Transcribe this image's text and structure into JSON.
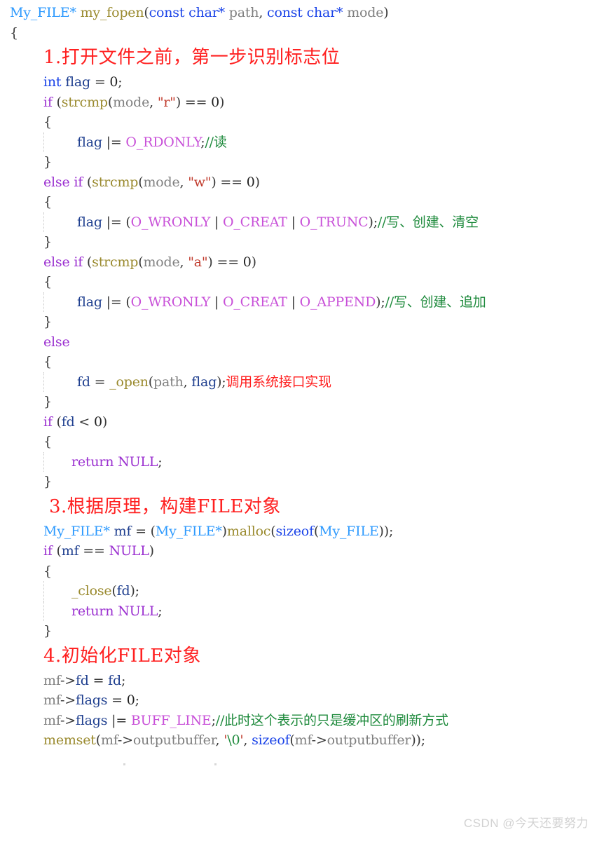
{
  "document": {
    "language": "C",
    "watermark": "CSDN @今天还要努力",
    "colors": {
      "type": "#2e9afe",
      "function": "#9a8a2e",
      "keyword": "#1a43e8",
      "control": "#9b30d0",
      "variable": "#1f3f8f",
      "plain": "#808080",
      "macro": "#c850d8",
      "string": "#c0392b",
      "comment": "#1e8a3c",
      "annotation": "#ff2020",
      "background": "#ffffff"
    }
  },
  "code": {
    "signature": {
      "ret_type": "My_FILE*",
      "name": " my_fopen",
      "paren_open": "(",
      "p1_type": "const char*",
      "p1_name": " path",
      "comma": ", ",
      "p2_type": "const char*",
      "p2_name": " mode",
      "paren_close": ")"
    },
    "brace_open_fn": "{",
    "note1": "1.打开文件之前，第一步识别标志位",
    "decl_flag": {
      "kw": "int",
      "var": " flag",
      "op": " = ",
      "num": "0",
      "semi": ";"
    },
    "if_r": {
      "ctl": "if",
      "op1": " (",
      "fn": "strcmp",
      "op2": "(",
      "arg": "mode",
      "comma": ", ",
      "str": "\"r\"",
      "op3": ") == ",
      "num": "0",
      "op4": ")"
    },
    "brace_open_r": "{",
    "flag_r": {
      "var": "flag",
      "op": " |= ",
      "mac": "O_RDONLY",
      "semi": ";",
      "cmt": "//读"
    },
    "brace_close_r": "}",
    "elseif_w": {
      "ctl": "else if",
      "op1": " (",
      "fn": "strcmp",
      "op2": "(",
      "arg": "mode",
      "comma": ", ",
      "str": "\"w\"",
      "op3": ") == ",
      "num": "0",
      "op4": ")"
    },
    "brace_open_w": "{",
    "flag_w": {
      "var": "flag",
      "op": " |= (",
      "m1": "O_WRONLY",
      "bar1": " | ",
      "m2": "O_CREAT",
      "bar2": " | ",
      "m3": "O_TRUNC",
      "op2": ");",
      "cmt": "//写、创建、清空"
    },
    "brace_close_w": "}",
    "elseif_a": {
      "ctl": "else if",
      "op1": " (",
      "fn": "strcmp",
      "op2": "(",
      "arg": "mode",
      "comma": ", ",
      "str": "\"a\"",
      "op3": ") == ",
      "num": "0",
      "op4": ")"
    },
    "brace_open_a": "{",
    "flag_a": {
      "var": "flag",
      "op": " |= (",
      "m1": "O_WRONLY",
      "bar1": " | ",
      "m2": "O_CREAT",
      "bar2": " | ",
      "m3": "O_APPEND",
      "op2": ");",
      "cmt": "//写、创建、追加"
    },
    "brace_close_a": "}",
    "else_kw": "else",
    "brace_open_else": "{",
    "open_call": {
      "var": "fd",
      "op": " = ",
      "fn": "_open",
      "op2": "(",
      "a1": "path",
      "comma": ", ",
      "a2": "flag",
      "op3": ");",
      "note": "调用系统接口实现"
    },
    "brace_close_else": "}",
    "if_fd": {
      "ctl": "if",
      "op1": " (",
      "var": "fd",
      "op2": " < ",
      "num": "0",
      "op3": ")"
    },
    "brace_open_fd": "{",
    "return_null_1": {
      "ctl": "return",
      "null": " NULL",
      "semi": ";"
    },
    "brace_close_fd": "}",
    "note3": "3.根据原理，构建FILE对象",
    "malloc_line": {
      "typ1": "My_FILE*",
      "var": " mf",
      "op": " = (",
      "typ2": "My_FILE*",
      "op2": ")",
      "fn": "malloc",
      "op3": "(",
      "kw": "sizeof",
      "op4": "(",
      "typ3": "My_FILE",
      "op5": "));"
    },
    "if_mf": {
      "ctl": "if",
      "op1": " (",
      "var": "mf",
      "op2": " == ",
      "null": "NULL",
      "op3": ")"
    },
    "brace_open_mf": "{",
    "close_call": {
      "fn": "_close",
      "op": "(",
      "arg": "fd",
      "op2": ");"
    },
    "return_null_2": {
      "ctl": "return",
      "null": " NULL",
      "semi": ";"
    },
    "brace_close_mf": "}",
    "note4": "4.初始化FILE对象",
    "mf_fd": {
      "var": "mf",
      "arrow": "->",
      "field": "fd",
      "op": " = ",
      "val": "fd",
      "semi": ";"
    },
    "mf_flags0": {
      "var": "mf",
      "arrow": "->",
      "field": "flags",
      "op": " = ",
      "num": "0",
      "semi": ";"
    },
    "mf_flags_line": {
      "var": "mf",
      "arrow": "->",
      "field": "flags",
      "op": " |= ",
      "mac": "BUFF_LINE",
      "semi": ";",
      "cmt": "//此时这个表示的只是缓冲区的刷新方式"
    },
    "memset_line": {
      "fn": "memset",
      "op": "(",
      "a1": "mf",
      "arrow": "->",
      "a1f": "outputbuffer",
      "comma1": ", ",
      "q1": "'",
      "esc": "\\0",
      "q2": "'",
      "comma2": ", ",
      "kw": "sizeof",
      "op2": "(",
      "a2": "mf",
      "arrow2": "->",
      "a2f": "outputbuffer",
      "op3": "));"
    }
  }
}
